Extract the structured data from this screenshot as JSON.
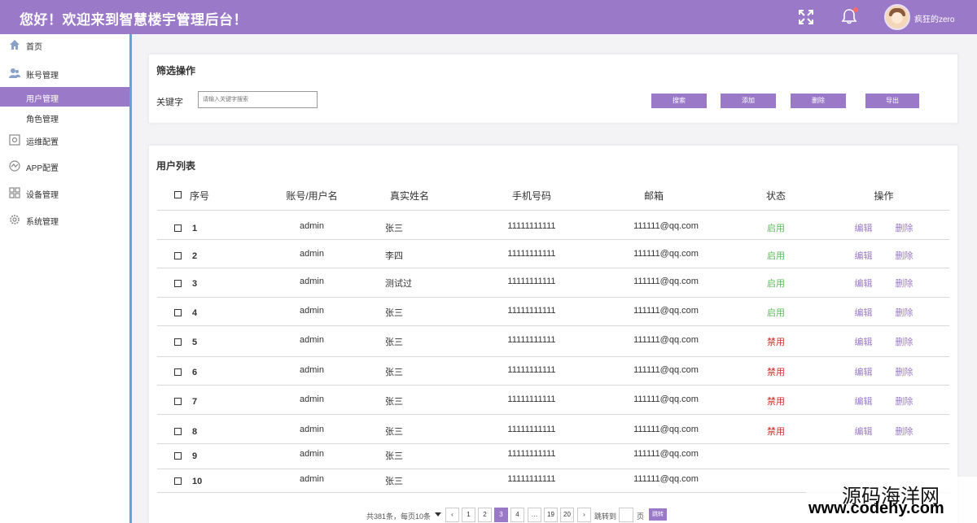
{
  "header": {
    "title": "您好！欢迎来到智慧楼宇管理后台！",
    "username": "疯狂的zero",
    "accent": "#9b79c9"
  },
  "sidebar": {
    "items": [
      {
        "label": "首页",
        "icon": "home-icon"
      },
      {
        "label": "账号管理",
        "icon": "users-icon"
      },
      {
        "label": "用户管理",
        "active": true
      },
      {
        "label": "角色管理"
      },
      {
        "label": "运维配置",
        "icon": "monitor-icon"
      },
      {
        "label": "APP配置",
        "icon": "app-icon"
      },
      {
        "label": "设备管理",
        "icon": "grid-icon"
      },
      {
        "label": "系统管理",
        "icon": "gear-icon"
      }
    ]
  },
  "filter": {
    "title": "筛选操作",
    "keyword_label": "关键字",
    "keyword_placeholder": "请输入关键字搜索",
    "buttons": [
      "搜索",
      "添加",
      "删除",
      "导出"
    ]
  },
  "table": {
    "title": "用户列表",
    "headers": [
      "序号",
      "账号/用户名",
      "真实姓名",
      "手机号码",
      "邮箱",
      "状态",
      "操作"
    ],
    "rows": [
      {
        "no": "1",
        "account": "admin",
        "name": "张三",
        "phone": "11111111111",
        "email": "111111@qq.com",
        "status": "启用",
        "edit": "编辑",
        "delete": "删除"
      },
      {
        "no": "2",
        "account": "admin",
        "name": "李四",
        "phone": "11111111111",
        "email": "111111@qq.com",
        "status": "启用",
        "edit": "编辑",
        "delete": "删除"
      },
      {
        "no": "3",
        "account": "admin",
        "name": "测试过",
        "phone": "11111111111",
        "email": "111111@qq.com",
        "status": "启用",
        "edit": "编辑",
        "delete": "删除"
      },
      {
        "no": "4",
        "account": "admin",
        "name": "张三",
        "phone": "11111111111",
        "email": "111111@qq.com",
        "status": "启用",
        "edit": "编辑",
        "delete": "删除"
      },
      {
        "no": "5",
        "account": "admin",
        "name": "张三",
        "phone": "11111111111",
        "email": "111111@qq.com",
        "status": "禁用",
        "edit": "编辑",
        "delete": "删除"
      },
      {
        "no": "6",
        "account": "admin",
        "name": "张三",
        "phone": "11111111111",
        "email": "111111@qq.com",
        "status": "禁用",
        "edit": "编辑",
        "delete": "删除"
      },
      {
        "no": "7",
        "account": "admin",
        "name": "张三",
        "phone": "11111111111",
        "email": "111111@qq.com",
        "status": "禁用",
        "edit": "编辑",
        "delete": "删除"
      },
      {
        "no": "8",
        "account": "admin",
        "name": "张三",
        "phone": "11111111111",
        "email": "111111@qq.com",
        "status": "禁用",
        "edit": "编辑",
        "delete": "删除"
      },
      {
        "no": "9",
        "account": "admin",
        "name": "张三",
        "phone": "11111111111",
        "email": "111111@qq.com",
        "status": "",
        "edit": "",
        "delete": ""
      },
      {
        "no": "10",
        "account": "admin",
        "name": "张三",
        "phone": "11111111111",
        "email": "111111@qq.com",
        "status": "",
        "edit": "",
        "delete": ""
      }
    ],
    "status_colors": {
      "启用": "#5cb85c",
      "禁用": "#c9302c"
    }
  },
  "pager": {
    "info": "共381条，每页10条",
    "prev": "‹",
    "pages": [
      "1",
      "2",
      "3",
      "4",
      "…",
      "19",
      "20"
    ],
    "current": "3",
    "next": "›",
    "goto_label": "跳转到",
    "page_unit": "页",
    "goto_button": "跳转"
  },
  "watermark": {
    "line1": "源码海洋网",
    "line2": "www.codehy.com"
  }
}
